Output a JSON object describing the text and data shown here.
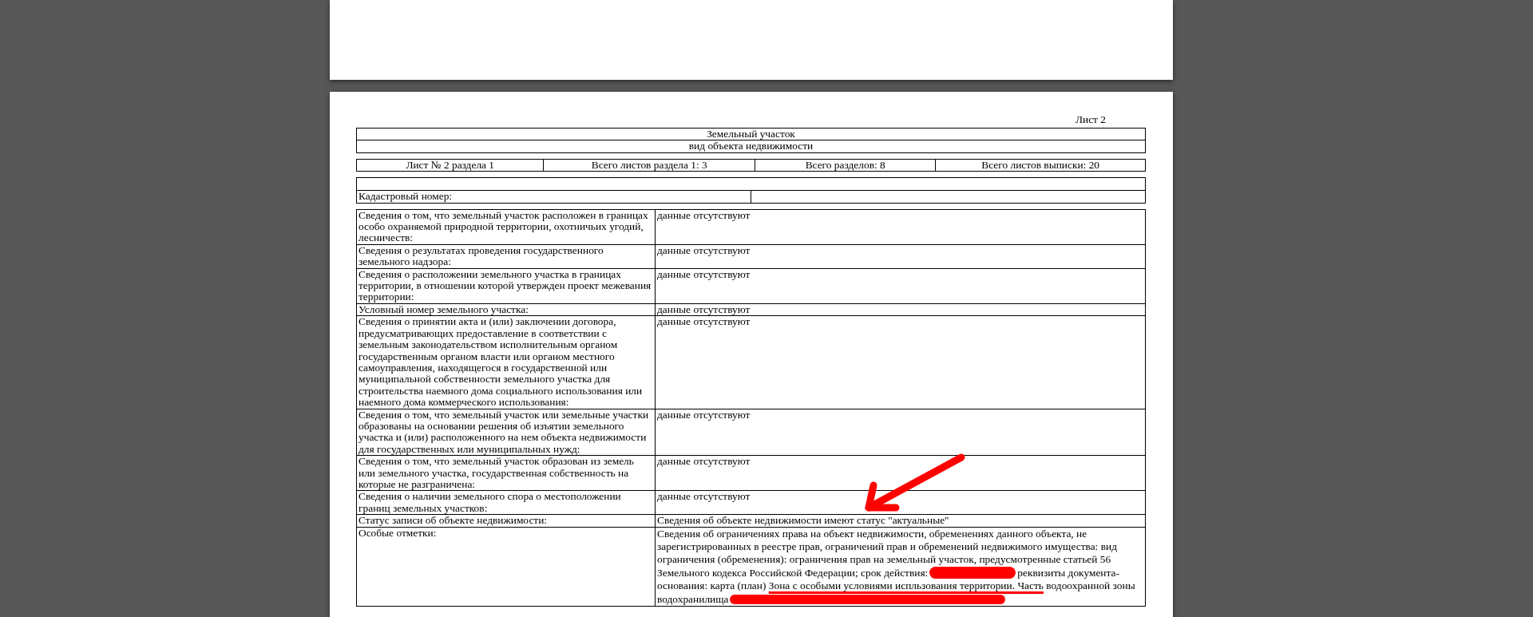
{
  "sheet_label": "Лист 2",
  "header": {
    "title": "Земельный участок",
    "subtitle": "вид объекта недвижимости"
  },
  "counters": [
    "Лист № 2 раздела 1",
    "Всего листов раздела 1: 3",
    "Всего разделов: 8",
    "Всего листов выписки: 20"
  ],
  "cadastral": {
    "label": "Кадастровый номер:"
  },
  "rows": [
    {
      "label": "Сведения о том, что земельный участок расположен в границах особо охраняемой природной территории, охотничьих угодий, лесничеств:",
      "value": [
        {
          "kind": "text",
          "text": "данные отсутствуют"
        }
      ]
    },
    {
      "label": "Сведения о результатах проведения государственного земельного надзора:",
      "value": [
        {
          "kind": "text",
          "text": "данные отсутствуют"
        }
      ]
    },
    {
      "label": "Сведения о расположении земельного участка в границах территории, в отношении которой утвержден проект межевания территории:",
      "value": [
        {
          "kind": "text",
          "text": "данные отсутствуют"
        }
      ]
    },
    {
      "label": "Условный номер земельного участка:",
      "value": [
        {
          "kind": "text",
          "text": "данные отсутствуют"
        }
      ]
    },
    {
      "label": "Сведения о принятии акта и (или) заключении договора, предусматривающих предоставление в соответствии с земельным законодательством исполнительным органом государственным органом власти или органом местного самоуправления, находящегося в государственной или муниципальной собственности земельного участка для строительства наемного дома социального использования или наемного дома коммерческого использования:",
      "value": [
        {
          "kind": "text",
          "text": "данные отсутствуют"
        }
      ]
    },
    {
      "label": "Сведения о том, что земельный участок или земельные участки образованы на основании решения об изъятии земельного участка и (или) расположенного на нем объекта недвижимости для государственных или муниципальных нужд:",
      "value": [
        {
          "kind": "text",
          "text": "данные отсутствуют"
        }
      ]
    },
    {
      "label": "Сведения о том, что земельный участок образован из земель или земельного участка, государственная собственность на которые не разграничена:",
      "value": [
        {
          "kind": "text",
          "text": "данные отсутствуют"
        }
      ]
    },
    {
      "label": "Сведения о наличии земельного спора  о местоположении границ земельных участков:",
      "value": [
        {
          "kind": "text",
          "text": "данные отсутствуют"
        }
      ]
    },
    {
      "label": "Статус записи об объекте недвижимости:",
      "value": [
        {
          "kind": "text",
          "text": "Сведения об объекте недвижимости имеют статус \"актуальные\""
        }
      ]
    },
    {
      "label": "Особые отметки:",
      "value": [
        {
          "kind": "text",
          "text": "Сведения об ограничениях права на объект недвижимости, обременениях данного объекта, не зарегистрированных в реестре прав, ограничений прав и обременений недвижимого имущества: вид ограничения (обременения): ограничения прав на земельный участок, предусмотренные статьей 56 Земельного кодекса Российской Федерации; срок действия:"
        },
        {
          "kind": "redaction"
        },
        {
          "kind": "text",
          "text": "реквизиты документа-основания: карта (план) "
        },
        {
          "kind": "marked",
          "text": "Зона с особыми условиями испльзования территории. Часть"
        },
        {
          "kind": "text",
          "text": " водоохранной зоны водохранилища"
        },
        {
          "kind": "redaction"
        }
      ]
    }
  ]
}
